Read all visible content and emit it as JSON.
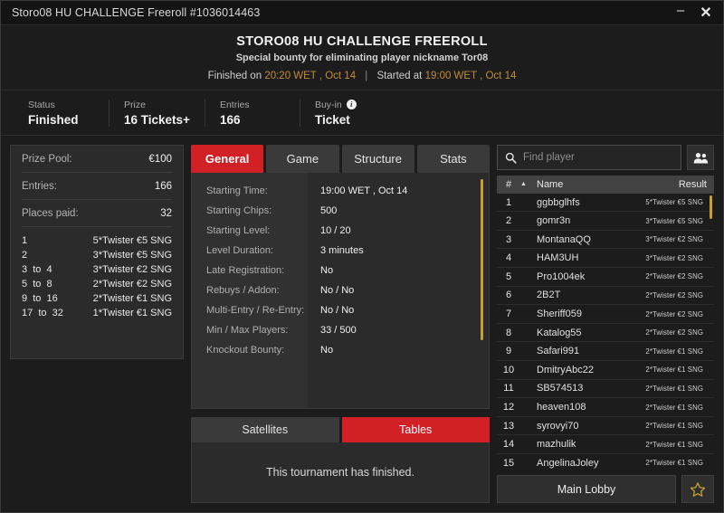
{
  "window": {
    "title": "Storo08 HU CHALLENGE Freeroll #1036014463",
    "minimize_label": "–",
    "close_label": "✕"
  },
  "header": {
    "title": "STORO08 HU CHALLENGE FREEROLL",
    "subtitle": "Special bounty for eliminating player nickname Tor08",
    "finished_prefix": "Finished on",
    "finished_time": "20:20 WET , Oct 14",
    "divider": "|",
    "started_prefix": "Started at",
    "started_time": "19:00 WET , Oct 14"
  },
  "status": {
    "items": [
      {
        "label": "Status",
        "value": "Finished"
      },
      {
        "label": "Prize",
        "value": "16 Tickets+"
      },
      {
        "label": "Entries",
        "value": "166"
      },
      {
        "label": "Buy-in",
        "value": "Ticket",
        "info": true
      }
    ]
  },
  "prize_panel": {
    "rows": [
      {
        "key": "Prize Pool:",
        "value": "€100"
      },
      {
        "key": "Entries:",
        "value": "166"
      },
      {
        "key": "Places paid:",
        "value": "32"
      }
    ],
    "payouts": [
      {
        "place": "1",
        "prize": "5*Twister €5 SNG"
      },
      {
        "place": "2",
        "prize": "3*Twister €5 SNG"
      },
      {
        "place": "3  to  4",
        "prize": "3*Twister €2 SNG"
      },
      {
        "place": "5  to  8",
        "prize": "2*Twister €2 SNG"
      },
      {
        "place": "9  to  16",
        "prize": "2*Twister €1 SNG"
      },
      {
        "place": "17  to  32",
        "prize": "1*Twister €1 SNG"
      }
    ]
  },
  "tabs": [
    {
      "label": "General",
      "active": true
    },
    {
      "label": "Game",
      "active": false
    },
    {
      "label": "Structure",
      "active": false
    },
    {
      "label": "Stats",
      "active": false
    }
  ],
  "details": [
    {
      "label": "Starting Time:",
      "value": "19:00 WET , Oct 14"
    },
    {
      "label": "Starting Chips:",
      "value": "500"
    },
    {
      "label": "Starting Level:",
      "value": "10 / 20"
    },
    {
      "label": "Level Duration:",
      "value": "3 minutes"
    },
    {
      "label": "Late Registration:",
      "value": "No"
    },
    {
      "label": "Rebuys / Addon:",
      "value": "No / No"
    },
    {
      "label": "Multi-Entry / Re-Entry:",
      "value": "No / No"
    },
    {
      "label": "Min / Max Players:",
      "value": "33 / 500"
    },
    {
      "label": "Knockout Bounty:",
      "value": "No"
    }
  ],
  "bottom_tabs": [
    {
      "label": "Satellites",
      "active": false
    },
    {
      "label": "Tables",
      "active": true
    }
  ],
  "finished_message": "This tournament has finished.",
  "search": {
    "placeholder": "Find player",
    "value": "",
    "icon": "search-icon",
    "people_icon": "people-icon"
  },
  "player_table": {
    "columns": {
      "num": "#",
      "sort": "▲",
      "name": "Name",
      "result": "Result"
    },
    "rows": [
      {
        "num": "1",
        "name": "ggbbglhfs",
        "result": "5*Twister €5 SNG"
      },
      {
        "num": "2",
        "name": "gomr3n",
        "result": "3*Twister €5 SNG"
      },
      {
        "num": "3",
        "name": "MontanaQQ",
        "result": "3*Twister €2 SNG"
      },
      {
        "num": "4",
        "name": "HAM3UH",
        "result": "3*Twister €2 SNG"
      },
      {
        "num": "5",
        "name": "Pro1004ek",
        "result": "2*Twister €2 SNG"
      },
      {
        "num": "6",
        "name": "2B2T",
        "result": "2*Twister €2 SNG"
      },
      {
        "num": "7",
        "name": "Sheriff059",
        "result": "2*Twister €2 SNG"
      },
      {
        "num": "8",
        "name": "Katalog55",
        "result": "2*Twister €2 SNG"
      },
      {
        "num": "9",
        "name": "Safari991",
        "result": "2*Twister €1 SNG"
      },
      {
        "num": "10",
        "name": "DmitryAbc22",
        "result": "2*Twister €1 SNG"
      },
      {
        "num": "11",
        "name": "SB574513",
        "result": "2*Twister €1 SNG"
      },
      {
        "num": "12",
        "name": "heaven108",
        "result": "2*Twister €1 SNG"
      },
      {
        "num": "13",
        "name": "syrovyi70",
        "result": "2*Twister €1 SNG"
      },
      {
        "num": "14",
        "name": "mazhulik",
        "result": "2*Twister €1 SNG"
      },
      {
        "num": "15",
        "name": "AngelinaJoley",
        "result": "2*Twister €1 SNG"
      }
    ]
  },
  "footer": {
    "main_lobby_label": "Main Lobby",
    "favorite_icon": "star-icon"
  },
  "colors": {
    "accent_red": "#d22027",
    "accent_gold": "#c18c34",
    "scrollbar": "#c9a030",
    "panel_bg": "#2b2b2b",
    "window_bg": "#1c1c1c"
  }
}
